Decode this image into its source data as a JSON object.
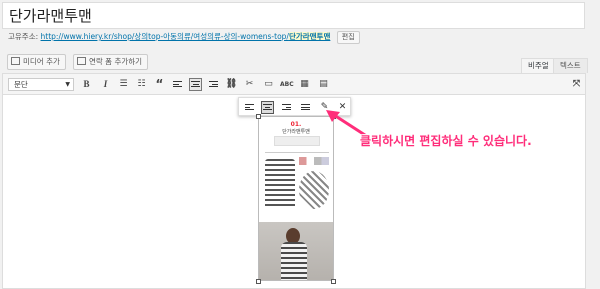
{
  "post": {
    "title": "단가라맨투맨",
    "permalink_label": "고유주소:",
    "permalink_url_prefix": "http://www.hiery.kr/shop/상의top-아동의류/여성의류-상의-womens-top/",
    "permalink_slug": "단가라맨투맨",
    "permalink_edit": "편집"
  },
  "media": {
    "add_media": "미디어 추가",
    "add_contact_form": "연락 폼 추가하기"
  },
  "tabs": [
    "비주얼",
    "텍스트"
  ],
  "toolbar": {
    "format": "문단",
    "buttons": [
      "bold-icon",
      "italic-icon",
      "bullet-list-icon",
      "numbered-list-icon",
      "blockquote-icon",
      "align-left-icon",
      "align-center-icon",
      "align-right-icon",
      "link-icon",
      "unlink-icon",
      "read-more-icon",
      "spellcheck-icon",
      "fullscreen-icon",
      "toolbar-toggle-icon"
    ],
    "active": "align-center-icon"
  },
  "image_toolbar": {
    "buttons": [
      "align-left-icon",
      "align-center-icon",
      "align-right-icon",
      "align-none-icon",
      "edit-pencil-icon",
      "remove-icon"
    ],
    "active": "align-center-icon"
  },
  "image": {
    "top_text": "01.",
    "subtitle": "단가라맨투맨"
  },
  "annotation": {
    "text": "클릭하시면 편집하실 수 있습니다.",
    "color": "#ff2d7a"
  },
  "colors": {
    "link": "#0073aa",
    "accent": "#ff2d7a"
  }
}
